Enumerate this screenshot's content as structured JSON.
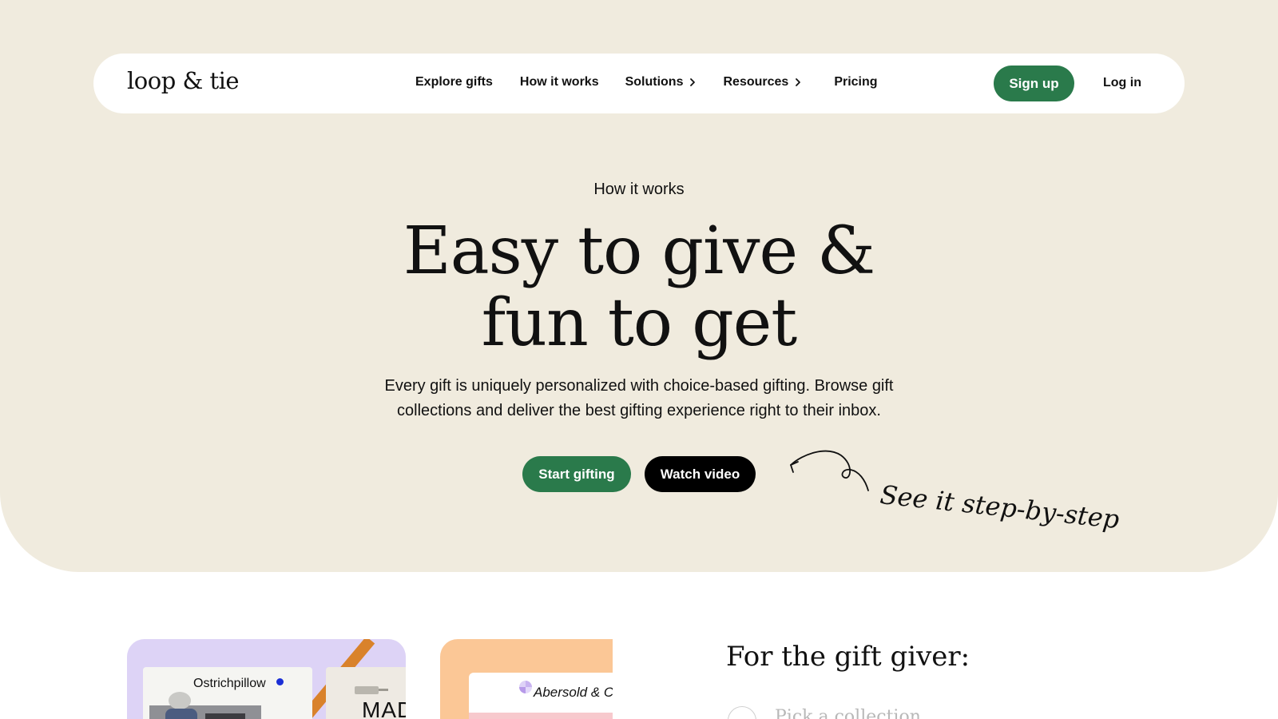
{
  "nav": {
    "logo": "loop & tie",
    "links": [
      {
        "label": "Explore gifts"
      },
      {
        "label": "How it works"
      },
      {
        "label": "Solutions"
      },
      {
        "label": "Resources"
      },
      {
        "label": "Pricing"
      }
    ],
    "signup_label": "Sign up",
    "login_label": "Log in"
  },
  "hero": {
    "eyebrow": "How it works",
    "headline_line1": "Easy to give &",
    "headline_line2": "fun to get",
    "subtext": "Every gift is uniquely personalized with choice-based gifting. Browse gift collections and deliver the best gifting experience right to their inbox.",
    "start_label": "Start gifting",
    "video_label": "Watch video",
    "handnote": "See it step-by-step"
  },
  "section": {
    "card1_brand": "Ostrichpillow",
    "card1_side_text": "MAD",
    "card2_brand": "Abersold & C",
    "title": "For the gift giver:",
    "step1_label": "Pick a collection"
  },
  "colors": {
    "hero_bg": "#f0ebde",
    "accent_green": "#2a7a4b",
    "card1_bg": "#ddd3f6",
    "card2_bg": "#fbc796"
  }
}
